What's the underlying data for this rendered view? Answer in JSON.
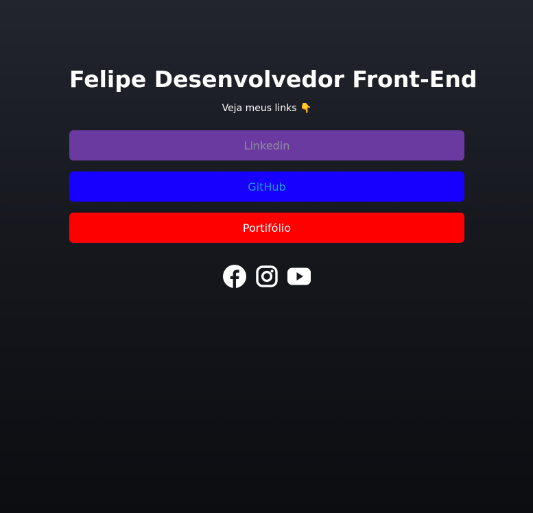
{
  "header": {
    "title": "Felipe Desenvolvedor Front-End",
    "subtitle": "Veja meus links 👇"
  },
  "links": [
    {
      "label": "Linkedin",
      "background": "#6a3aa1",
      "text_color": "#8f8f9f"
    },
    {
      "label": "GitHub",
      "background": "#1800ff",
      "text_color": "#1e9cd6"
    },
    {
      "label": "Portifólio",
      "background": "#ff0000",
      "text_color": "#ffffff"
    }
  ],
  "social": [
    {
      "icon": "facebook-icon"
    },
    {
      "icon": "instagram-icon"
    },
    {
      "icon": "youtube-icon"
    }
  ],
  "colors": {
    "background_top": "#22252e",
    "background_bottom": "#0c0d11",
    "icon_color": "#ffffff"
  }
}
